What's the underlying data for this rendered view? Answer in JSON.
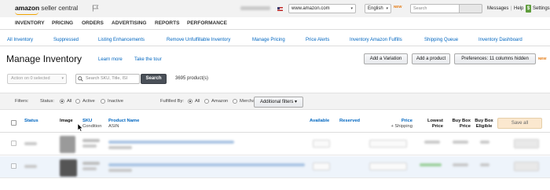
{
  "topbar": {
    "logo_brand": "amazon",
    "logo_product": " seller central",
    "marketplace": "www.amazon.com",
    "language": "English",
    "new_badge": "NEW",
    "search_placeholder": "Search",
    "messages": "Messages",
    "help": "Help",
    "settings": "Settings",
    "separator": "|"
  },
  "mainnav": [
    "INVENTORY",
    "PRICING",
    "ORDERS",
    "ADVERTISING",
    "REPORTS",
    "PERFORMANCE"
  ],
  "subtabs": [
    "All Inventory",
    "Suppressed",
    "Listing Enhancements",
    "Remove Unfulfillable Inventory",
    "Manage Pricing",
    "Price Alerts",
    "Inventory Amazon Fulfills",
    "Shipping Queue",
    "Inventory Dashboard"
  ],
  "page": {
    "title": "Manage Inventory",
    "learn_more": "Learn more",
    "take_tour": "Take the tour",
    "add_variation": "Add a Variation",
    "add_product": "Add a product",
    "preferences": "Preferences: 11 columns hidden",
    "preferences_badge": "NEW"
  },
  "actions": {
    "action_select": "Action on 0 selected",
    "search_placeholder": "Search SKU, Title, ISI",
    "search_button": "Search",
    "product_count": "3695 product(s)"
  },
  "filters": {
    "label": "Filters:",
    "status_label": "Status:",
    "status_options": [
      "All",
      "Active",
      "Inactive"
    ],
    "fulfilled_label": "Fulfilled By:",
    "fulfilled_options": [
      "All",
      "Amazon",
      "Merchant"
    ],
    "additional": "Additional filters",
    "additional_caret": "▾"
  },
  "table": {
    "headers": {
      "status": "Status",
      "image": "Image",
      "sku": "SKU",
      "condition": "Condition",
      "product_name": "Product Name",
      "asin": "ASIN",
      "available": "Available",
      "reserved": "Reserved",
      "price": "Price",
      "shipping": "+ Shipping",
      "lowest_price_1": "Lowest",
      "lowest_price_2": "Price",
      "buybox_price_1": "Buy Box",
      "buybox_price_2": "Price",
      "buybox_elig_1": "Buy Box",
      "buybox_elig_2": "Eligible"
    },
    "save_all": "Save all"
  },
  "colors": {
    "link": "#0066c0",
    "nav_bg": "#f2f2f2",
    "search_btn": "#4a5058",
    "save_all_bg": "#fbe8cf",
    "new_badge": "#e47911",
    "help_icon": "#5e9c3b"
  },
  "icons": [
    "flag-icon",
    "search-icon",
    "help-icon",
    "cursor-icon"
  ]
}
